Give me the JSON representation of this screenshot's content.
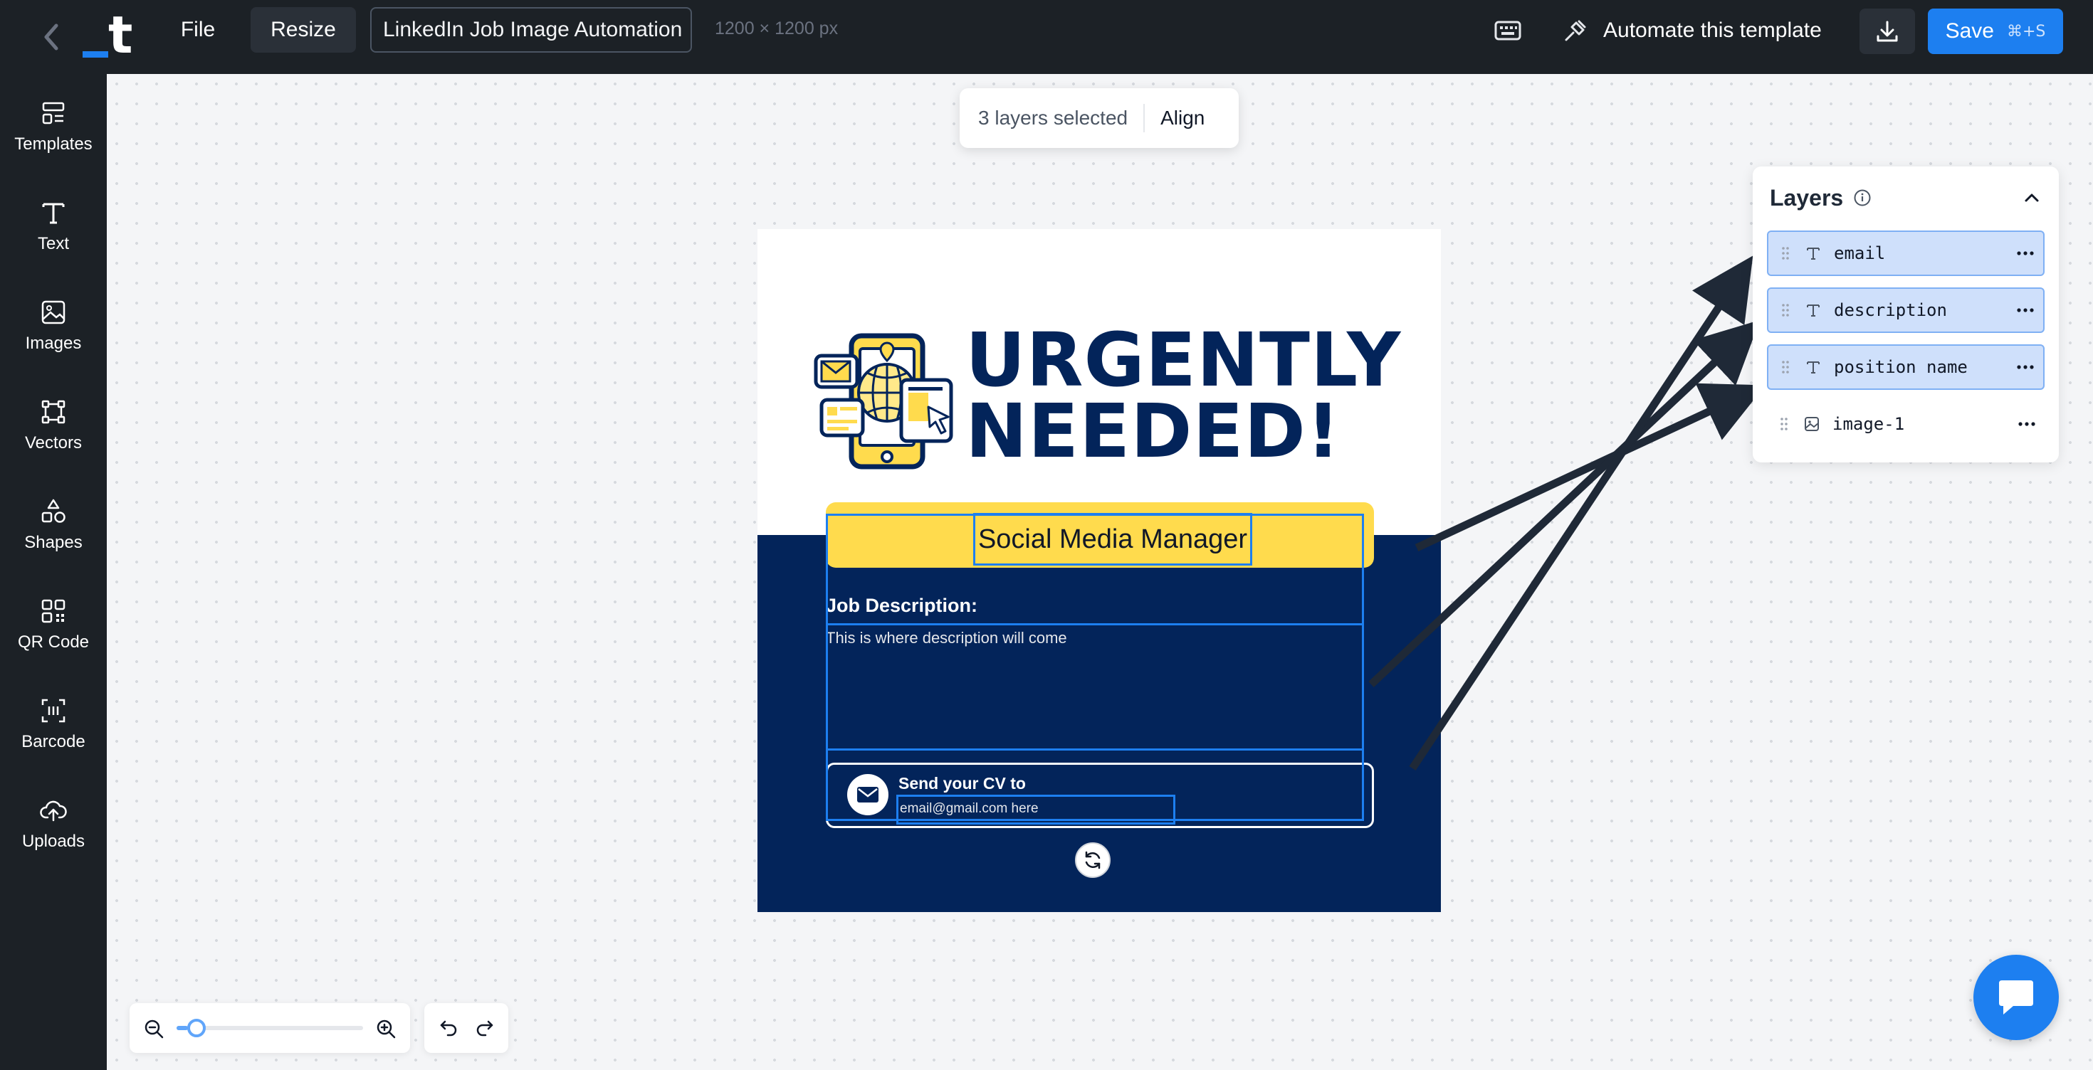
{
  "app": {
    "doc_title": "LinkedIn Job Image Automation",
    "dimensions": "1200 × 1200 px"
  },
  "toolbar": {
    "file_label": "File",
    "resize_label": "Resize",
    "automate_label": "Automate this template",
    "save_label": "Save",
    "save_shortcut": "⌘+S"
  },
  "sidebar": {
    "items": [
      {
        "label": "Templates",
        "icon": "templates-icon"
      },
      {
        "label": "Text",
        "icon": "text-icon"
      },
      {
        "label": "Images",
        "icon": "image-icon"
      },
      {
        "label": "Vectors",
        "icon": "vector-icon"
      },
      {
        "label": "Shapes",
        "icon": "shapes-icon"
      },
      {
        "label": "QR Code",
        "icon": "qr-code-icon"
      },
      {
        "label": "Barcode",
        "icon": "barcode-icon"
      },
      {
        "label": "Uploads",
        "icon": "upload-icon"
      }
    ]
  },
  "selection": {
    "count_label": "3 layers selected",
    "align_label": "Align"
  },
  "design": {
    "headline_line1": "URGENTLY",
    "headline_line2": "NEEDED!",
    "position_name": "Social Media Manager",
    "job_desc_label": "Job Description:",
    "description": "This is where description will come",
    "send_cv_label": "Send your CV to",
    "email": "email@gmail.com here",
    "colors": {
      "navy": "#03245a",
      "yellow": "#ffdb4d",
      "selection": "#1d7ff0"
    }
  },
  "layers": {
    "title": "Layers",
    "items": [
      {
        "name": "email",
        "type": "text",
        "selected": true
      },
      {
        "name": "description",
        "type": "text",
        "selected": true
      },
      {
        "name": "position name",
        "type": "text",
        "selected": true
      },
      {
        "name": "image-1",
        "type": "image",
        "selected": false
      }
    ]
  },
  "zoom": {
    "level_fraction": 0.06
  }
}
